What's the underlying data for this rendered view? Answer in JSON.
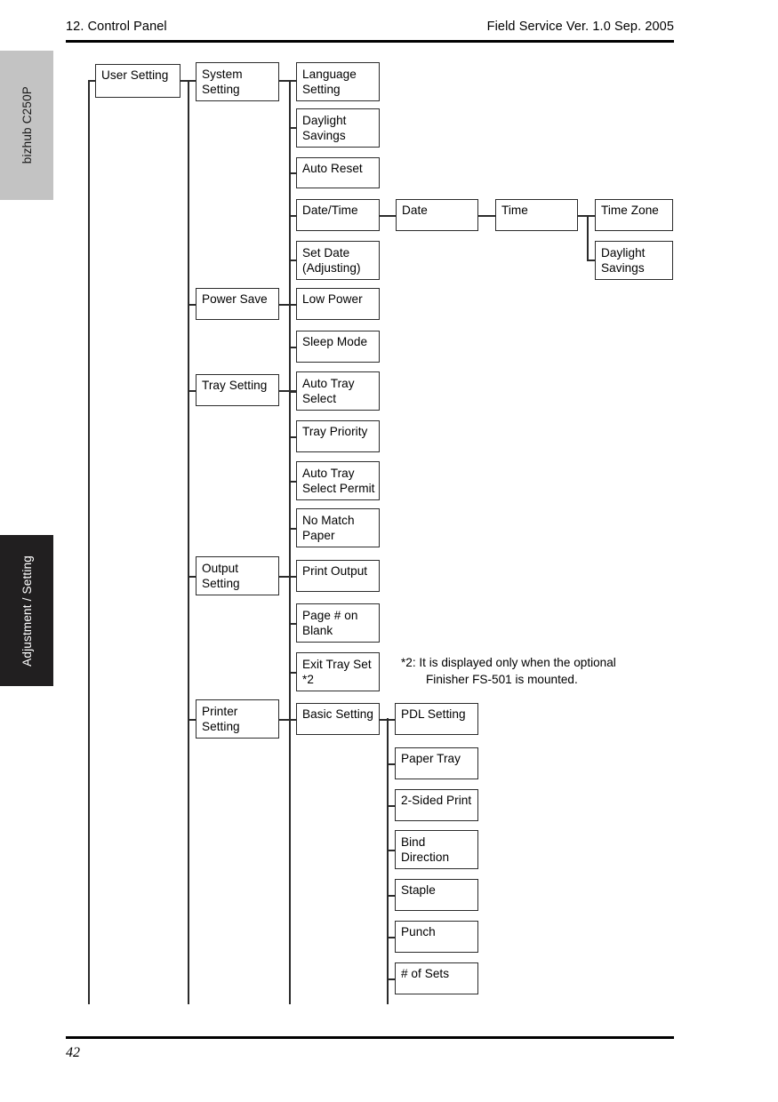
{
  "header": {
    "left": "12. Control Panel",
    "right": "Field Service Ver. 1.0 Sep. 2005"
  },
  "footer": {
    "page_number": "42"
  },
  "side_tabs": {
    "product": "bizhub C250P",
    "section": "Adjustment / Setting"
  },
  "footnote": {
    "line1": "*2: It is displayed only when the optional",
    "line2": "Finisher FS-501 is mounted."
  },
  "tree": {
    "root": "User Setting",
    "level2": {
      "system_setting": "System Setting",
      "power_save": "Power Save",
      "tray_setting": "Tray Setting",
      "output_setting": "Output Setting",
      "printer_setting": "Printer Setting"
    },
    "system_setting_children": [
      "Language Setting",
      "Daylight Savings",
      "Auto Reset",
      "Date/Time",
      "Set Date (Adjusting)"
    ],
    "date_time_chain": {
      "date": "Date",
      "time": "Time",
      "time_children": [
        "Time Zone",
        "Daylight Savings"
      ]
    },
    "power_save_children": [
      "Low Power",
      "Sleep Mode"
    ],
    "tray_setting_children": [
      "Auto Tray Select",
      "Tray Priority",
      "Auto Tray Select Permit",
      "No Match Paper"
    ],
    "output_setting_children": [
      "Print Output",
      "Page # on Blank",
      "Exit Tray Set *2"
    ],
    "printer_setting_children": [
      "Basic Setting"
    ],
    "basic_setting_children": [
      "PDL Setting",
      "Paper Tray",
      "2-Sided Print",
      "Bind Direction",
      "Staple",
      "Punch",
      "# of Sets"
    ]
  }
}
